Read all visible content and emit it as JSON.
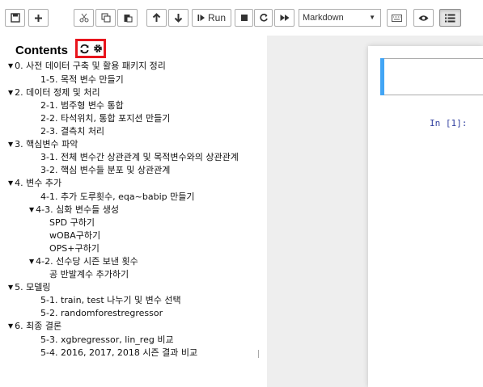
{
  "toolbar": {
    "run_label": "Run",
    "cell_type": "Markdown",
    "buttons": [
      "save-icon",
      "plus-icon",
      "scissors-icon",
      "copy-icon",
      "paste-icon",
      "arrow-up-icon",
      "arrow-down-icon",
      "run-icon",
      "stop-icon",
      "restart-icon",
      "fast-forward-icon",
      "keyboard-icon",
      "eye-icon",
      "list-icon"
    ]
  },
  "toc": {
    "title": "Contents",
    "items": [
      {
        "text": "0. 사전 데이터 구축 및 활용 패키지 정리",
        "collapsible": true
      },
      {
        "text": "1-5. 목적 변수 만들기",
        "collapsible": false
      },
      {
        "text": "2. 데이터 정제 및 처리",
        "collapsible": true
      },
      {
        "text": "2-1. 범주형 변수 통합",
        "collapsible": false
      },
      {
        "text": "2-2. 타석위치, 통합 포지션 만들기",
        "collapsible": false
      },
      {
        "text": "2-3. 결측치 처리",
        "collapsible": false
      },
      {
        "text": "3. 핵심변수 파악",
        "collapsible": true
      },
      {
        "text": "3-1. 전체 변수간 상관관계 및 목적변수와의 상관관계",
        "collapsible": false
      },
      {
        "text": "3-2. 핵심 변수들 분포 및 상관관계",
        "collapsible": false
      },
      {
        "text": "4. 변수 추가",
        "collapsible": true
      },
      {
        "text": "4-1. 추가 도루횟수, eqa~babip 만들기",
        "collapsible": false
      },
      {
        "text": "4-3. 심화 변수들 생성",
        "collapsible": true
      },
      {
        "text": "SPD 구하기",
        "collapsible": false
      },
      {
        "text": "wOBA구하기",
        "collapsible": false
      },
      {
        "text": "OPS+구하기",
        "collapsible": false
      },
      {
        "text": "4-2. 선수당 시즌 보낸 횟수",
        "collapsible": true
      },
      {
        "text": "공 반발계수 추가하기",
        "collapsible": false
      },
      {
        "text": "5. 모델링",
        "collapsible": true
      },
      {
        "text": "5-1. train, test 나누기 및 변수 선택",
        "collapsible": false
      },
      {
        "text": "5-2. randomforestregressor",
        "collapsible": false
      },
      {
        "text": "6. 최종 결론",
        "collapsible": true
      },
      {
        "text": "5-3. xgbregressor, lin_reg 비교",
        "collapsible": false
      },
      {
        "text": "5-4. 2016, 2017, 2018 시즌 결과 비교",
        "collapsible": false
      }
    ]
  },
  "notebook": {
    "prompt": "In [1]:"
  },
  "colors": {
    "highlight_box": "#e8141c",
    "cell_accent": "#42a5f5",
    "prompt": "#303f9f"
  }
}
